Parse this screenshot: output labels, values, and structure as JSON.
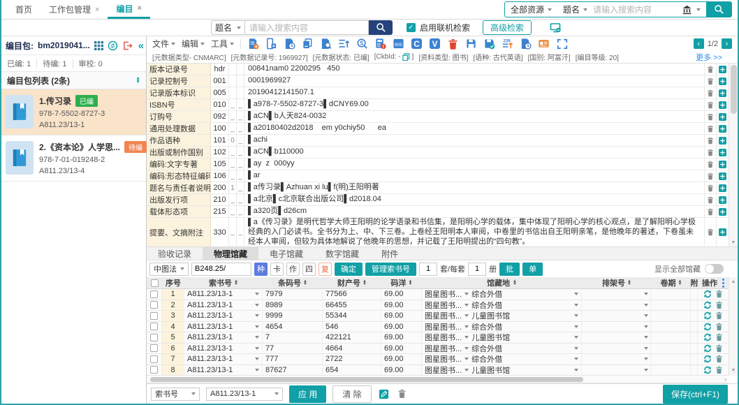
{
  "colors": {
    "accent": "#11a0a6",
    "navy_button": "#24437a",
    "link_blue": "#2d8cf0",
    "icon_blue": "#3b82d0",
    "badge_done": "#2fae4e",
    "badge_pending": "#f08552",
    "selected_item_bg": "#f9e3c9",
    "field_name_bg": "#fbf3dd"
  },
  "icons": {
    "toolbar": [
      "add-record",
      "new-field",
      "record-history",
      "copy-record",
      "record-search",
      "sort-fields",
      "template-search",
      "record-check",
      "field-905",
      "circle-c",
      "circle-v",
      "delete-record",
      "save",
      "save-check",
      "z3950",
      "record-time",
      "card-view",
      "fullscreen"
    ],
    "other": [
      "bank",
      "search",
      "monitor-settings",
      "copy",
      "grid",
      "sync",
      "exit",
      "collapse",
      "book",
      "refresh",
      "trash",
      "edit",
      "plus"
    ]
  },
  "tabs": {
    "home": "首页",
    "workpkg": "工作包管理",
    "catalog": "编目",
    "close": "×"
  },
  "global_search": {
    "scope": "全部资源",
    "field": "题名",
    "placeholder": "请输入搜索内容"
  },
  "online_search": {
    "field": "题名",
    "placeholder": "请输入搜索内容",
    "check": "✓",
    "checkbox_label": "启用联机检索",
    "advanced_label": "高级检索"
  },
  "sidebar": {
    "package_label": "编目包:",
    "package_id": "bm2019041...",
    "stats": [
      {
        "label": "已编:",
        "value": "1"
      },
      {
        "label": "待编:",
        "value": "1"
      },
      {
        "label": "审校:",
        "value": "0"
      }
    ],
    "list_title": "编目包列表 (2条)",
    "items": [
      {
        "title": "1.传习录",
        "badge": "已编",
        "isbn": "978-7-5502-8727-3",
        "callno": "A811.23/13-1"
      },
      {
        "title": "2.《资本论》人学思...",
        "badge": "待编",
        "isbn": "978-7-01-019248-2",
        "callno": "A811.23/13-4"
      }
    ]
  },
  "toolbar": {
    "menus": [
      {
        "label": "文件"
      },
      {
        "label": "编辑"
      },
      {
        "label": "工具"
      }
    ],
    "page": "1/2",
    "prev": "‹",
    "next": "›"
  },
  "meta_bar": {
    "items": [
      "[元数据类型- CNMARC]",
      "[元数据记录号: 1969927]",
      "[元数据状态: 已编]"
    ],
    "ckbid_prefix": "[CkbId: -",
    "ckbid_suffix": "]",
    "items2": [
      "[资料类型: 图书]",
      "[语种: 古代英语]",
      "[国别: 阿富汗]",
      "[编目等级: 20]"
    ],
    "more": "更多 >>"
  },
  "marc": {
    "rows": [
      {
        "name": "版本记录号",
        "tag": "hdr",
        "i1": "",
        "i2": "",
        "value": "00841nam0 2200295   450"
      },
      {
        "name": "记录控制号",
        "tag": "001",
        "i1": "",
        "i2": "",
        "value": "0001969927"
      },
      {
        "name": "记录版本标识",
        "tag": "005",
        "i1": "",
        "i2": "",
        "value": "20190412141507.1"
      },
      {
        "name": "ISBN号",
        "tag": "010",
        "i1": "_",
        "i2": "_",
        "value": "▌a978-7-5502-8727-3▌dCNY69.00"
      },
      {
        "name": "订购号",
        "tag": "092",
        "i1": "_",
        "i2": "_",
        "value": "▌aCN▌b人天824-0032"
      },
      {
        "name": "通用处理数据",
        "tag": "100",
        "i1": "_",
        "i2": "_",
        "value": "▌a20180402d2018    em y0chiy50      ea"
      },
      {
        "name": "作品语种",
        "tag": "101",
        "i1": "0",
        "i2": "_",
        "value": "▌achi"
      },
      {
        "name": "出版或制作国别",
        "tag": "102",
        "i1": "_",
        "i2": "_",
        "value": "▌aCN▌b110000"
      },
      {
        "name": "编码:文字专著",
        "tag": "105",
        "i1": "_",
        "i2": "_",
        "value": "▌ay  z  000yy"
      },
      {
        "name": "编码:形态特征编码",
        "tag": "106",
        "i1": "_",
        "i2": "_",
        "value": "▌ar"
      },
      {
        "name": "题名与责任者说明",
        "tag": "200",
        "i1": "1",
        "i2": "_",
        "value": "▌a传习录▌Azhuan xi lu▌f(明)王阳明著"
      },
      {
        "name": "出版发行项",
        "tag": "210",
        "i1": "_",
        "i2": "_",
        "value": "▌a北京▌c北京联合出版公司▌d2018.04"
      },
      {
        "name": "载体形态项",
        "tag": "215",
        "i1": "_",
        "i2": "_",
        "value": "▌a320页▌d26cm"
      },
      {
        "name": "提要、文摘附注",
        "tag": "330",
        "i1": "_",
        "i2": "_",
        "value": "▌a《传习录》是明代哲学大师王阳明的论学语录和书信集，是阳明心学的载体，集中体现了阳明心学的核心观点，是了解阳明心学极经典的入门必读书。全书分为上、中、下三卷。上卷经王阳明本人审阅，中卷里的书信出自王阳明亲笔，是他晚年的著述，下卷虽未经本人审阅，但较为具体地解说了他晚年的思想，并记载了王阳明提出的“四句教”。"
      }
    ]
  },
  "holdings": {
    "tabs": [
      "验收记录",
      "物理馆藏",
      "电子馆藏",
      "数字馆藏",
      "附件"
    ],
    "toolbar": {
      "class_scheme": "中图法",
      "callno_input": "B248.25/",
      "btn_zhong": "种",
      "btn_ka": "卡",
      "btn_zuo": "作",
      "btn_si": "四",
      "btn_fu": "复",
      "btn_confirm": "确定",
      "btn_manage": "管理索书号",
      "copies": "1",
      "label_set": "套/每套",
      "per_set": "1",
      "label_vol": "册",
      "btn_batch": "批",
      "btn_single": "单",
      "show_all": "显示全部馆藏"
    },
    "table": {
      "headers": {
        "no": "序号",
        "callno": "索书号",
        "barcode": "条码号",
        "asset": "财产号",
        "price": "码洋",
        "lib": "馆藏地",
        "shelf": "排架号",
        "vol": "卷期",
        "clipped": "附",
        "op": "操作"
      },
      "rows": [
        {
          "no": "1",
          "callno": "A811.23/13-1",
          "barcode": "7979",
          "asset": "77566",
          "price": "69.00",
          "lib": "图星图书...",
          "loc": "综合外借"
        },
        {
          "no": "2",
          "callno": "A811.23/13-1",
          "barcode": "8989",
          "asset": "66455",
          "price": "69.00",
          "lib": "图星图书...",
          "loc": "综合外借"
        },
        {
          "no": "3",
          "callno": "A811.23/13-1",
          "barcode": "9999",
          "asset": "55344",
          "price": "69.00",
          "lib": "图星图书...",
          "loc": "儿童图书馆"
        },
        {
          "no": "4",
          "callno": "A811.23/13-1",
          "barcode": "4654",
          "asset": "546",
          "price": "69.00",
          "lib": "图星图书...",
          "loc": "综合外借"
        },
        {
          "no": "5",
          "callno": "A811.23/13-1",
          "barcode": "7",
          "asset": "422121",
          "price": "69.00",
          "lib": "图星图书...",
          "loc": "儿童图书馆"
        },
        {
          "no": "6",
          "callno": "A811.23/13-1",
          "barcode": "77",
          "asset": "4664",
          "price": "69.00",
          "lib": "图星图书...",
          "loc": "综合外借"
        },
        {
          "no": "7",
          "callno": "A811.23/13-1",
          "barcode": "777",
          "asset": "2722",
          "price": "69.00",
          "lib": "图星图书...",
          "loc": "综合外借"
        },
        {
          "no": "8",
          "callno": "A811.23/13-1",
          "barcode": "87627",
          "asset": "654",
          "price": "69.00",
          "lib": "图星图书...",
          "loc": "儿童图书馆"
        }
      ]
    },
    "footer": {
      "field_select": "索书号",
      "value_select": "A811.23/13-1",
      "apply": "应 用",
      "clear": "清 除",
      "save": "保存(ctrl+F1)"
    }
  }
}
